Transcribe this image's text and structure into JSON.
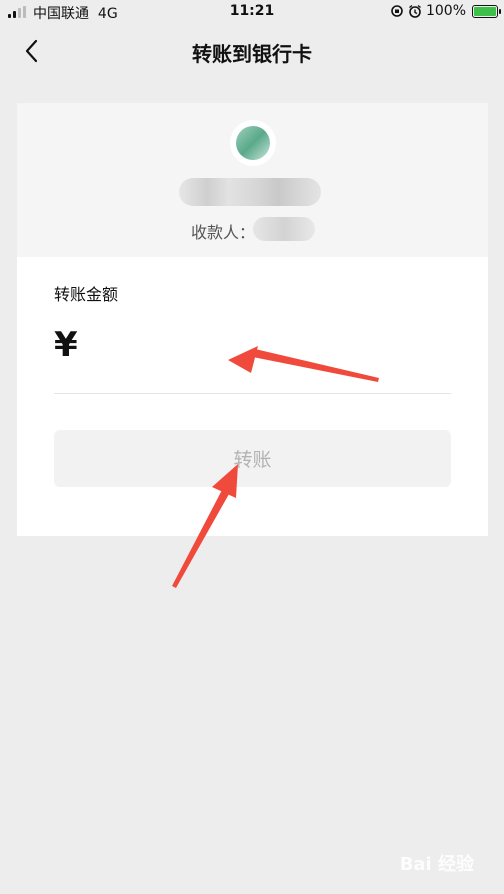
{
  "status_bar": {
    "carrier": "中国联通",
    "network": "4G",
    "time": "11:21",
    "battery": "100%",
    "icons": [
      "signal-icon",
      "alarm-lock-icon",
      "alarm-icon",
      "battery-charging-icon"
    ]
  },
  "nav": {
    "title": "转账到银行卡",
    "back_icon": "chevron-left-icon"
  },
  "payee": {
    "label": "收款人："
  },
  "form": {
    "amount_label": "转账金额",
    "currency_symbol": "¥",
    "amount_value": "",
    "button_label": "转账"
  },
  "colors": {
    "background": "#ededed",
    "card": "#ffffff",
    "button_disabled_bg": "#f2f2f2",
    "button_disabled_text": "#b3b3b3",
    "annotation_arrow": "#f04a3c"
  },
  "watermark": "Bai 经验"
}
